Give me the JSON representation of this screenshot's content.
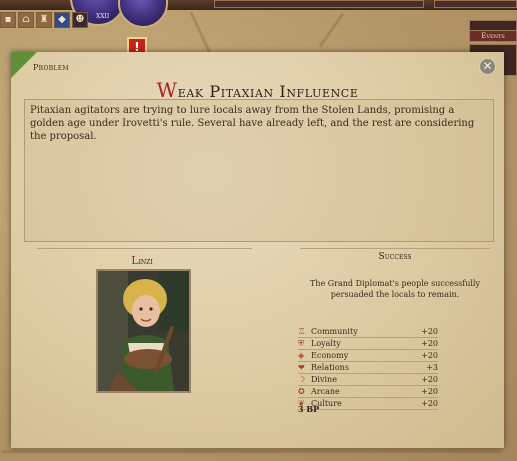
{
  "dialog": {
    "category": "Problem",
    "title_initial": "W",
    "title_rest": "eak Pitaxian Influence",
    "description": "Pitaxian agitators are trying to lure locals away from the Stolen Lands, promising a golden age under Irovetti's rule. Several have already left, and the rest are considering the proposal.",
    "close_glyph": "✕"
  },
  "advisor": {
    "name_initial": "L",
    "name_rest": "inzi"
  },
  "result": {
    "label": "Success",
    "description": "The Grand Diplomat's people successfully persuaded the locals to remain.",
    "stats": [
      {
        "icon": "community-icon",
        "glyph": "♖",
        "name": "Community",
        "value": "+20"
      },
      {
        "icon": "loyalty-icon",
        "glyph": "⛨",
        "name": "Loyalty",
        "value": "+20"
      },
      {
        "icon": "economy-icon",
        "glyph": "◈",
        "name": "Economy",
        "value": "+20"
      },
      {
        "icon": "relations-icon",
        "glyph": "❤",
        "name": "Relations",
        "value": "+3"
      },
      {
        "icon": "divine-icon",
        "glyph": "☽",
        "name": "Divine",
        "value": "+20"
      },
      {
        "icon": "arcane-icon",
        "glyph": "✪",
        "name": "Arcane",
        "value": "+20"
      },
      {
        "icon": "culture-icon",
        "glyph": "❦",
        "name": "Culture",
        "value": "+20"
      }
    ],
    "bp": "3 BP"
  },
  "hud": {
    "events_label": "Events",
    "alert_glyph": "!",
    "orb_label": "XXII",
    "colors": {
      "accent_red": "#a9222a",
      "parchment": "#e9dcbd",
      "ribbon_green": "#5f8f3a",
      "alert_red": "#c8231b"
    }
  }
}
